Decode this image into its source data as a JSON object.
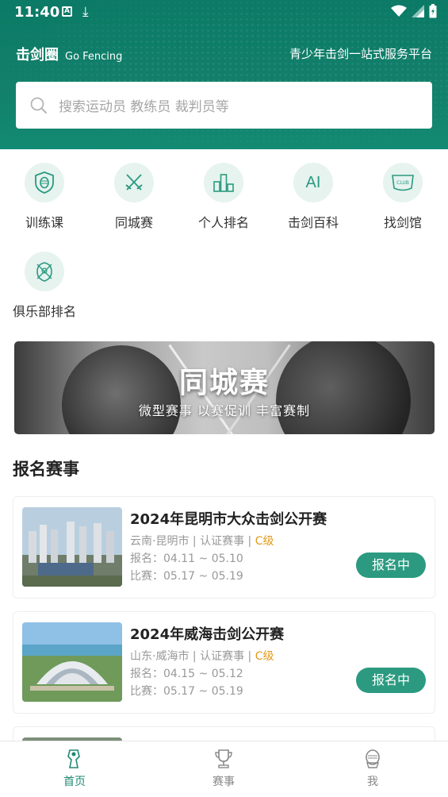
{
  "status_bar": {
    "time": "11:40",
    "a_badge": "A"
  },
  "header": {
    "brand_cn": "击剑圈",
    "brand_en": "Go Fencing",
    "slogan": "青少年击剑一站式服务平台"
  },
  "search": {
    "placeholder": "搜索运动员 教练员 裁判员等"
  },
  "quick_links": [
    {
      "label": "训练课",
      "icon": "shield-mask-icon"
    },
    {
      "label": "同城赛",
      "icon": "crossed-swords-icon"
    },
    {
      "label": "个人排名",
      "icon": "bar-ranking-icon"
    },
    {
      "label": "击剑百科",
      "icon": "ai-icon",
      "icon_text": "AI"
    },
    {
      "label": "找剑馆",
      "icon": "club-icon",
      "icon_text": "CLUB"
    },
    {
      "label": "俱乐部排名",
      "icon": "club-crest-icon"
    }
  ],
  "banner": {
    "title": "同城赛",
    "subtitle": "微型赛事  以赛促训  丰富赛制"
  },
  "section": {
    "title": "报名赛事"
  },
  "events": [
    {
      "name": "2024年昆明市大众击剑公开赛",
      "location": "云南·昆明市",
      "category": "认证赛事",
      "level": "C级",
      "separator": " | ",
      "signup": "报名：04.11 ~ 05.10",
      "match": "比赛：05.17 ~ 05.19",
      "button": "报名中"
    },
    {
      "name": "2024年威海击剑公开赛",
      "location": "山东·威海市",
      "category": "认证赛事",
      "level": "C级",
      "separator": " | ",
      "signup": "报名：04.15 ~ 05.12",
      "match": "比赛：05.17 ~ 05.19",
      "button": "报名中"
    }
  ],
  "tabbar": [
    {
      "label": "首页",
      "icon": "home-fencer-icon",
      "active": true
    },
    {
      "label": "赛事",
      "icon": "trophy-icon",
      "active": false
    },
    {
      "label": "我",
      "icon": "fencer-mask-icon",
      "active": false
    }
  ],
  "colors": {
    "brand_green": "#12806b",
    "button_green": "#2b9a80",
    "level_orange": "#e39a1a",
    "icon_circle": "#e6f3ef"
  }
}
